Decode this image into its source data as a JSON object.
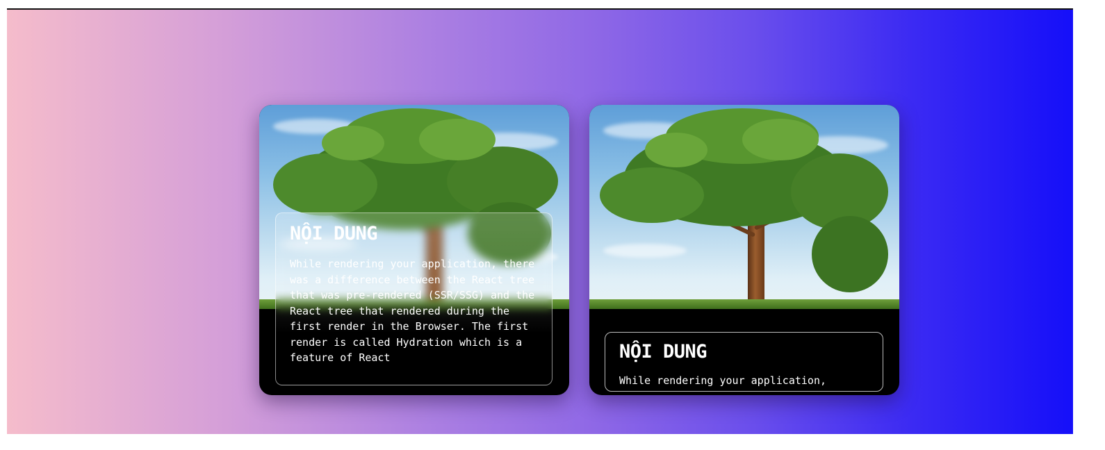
{
  "cards": [
    {
      "title": "NỘI DUNG",
      "body": "While rendering your application, there was a difference between the React tree that was pre-rendered (SSR/SSG) and the React tree that rendered during the first render in the Browser. The first render is called Hydration which is a feature of React"
    },
    {
      "title": "NỘI DUNG",
      "body": "While rendering your application,"
    }
  ],
  "colors": {
    "gradient_start": "#f5bccb",
    "gradient_end": "#150ff9",
    "card_background": "#000000",
    "text": "#ffffff"
  }
}
